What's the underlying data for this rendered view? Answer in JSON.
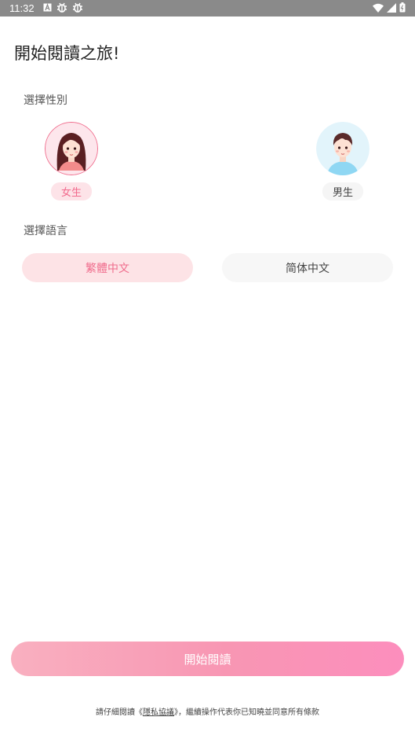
{
  "status_bar": {
    "time": "11:32",
    "left_icons": [
      "a-box-icon",
      "bug-icon",
      "bug-icon"
    ],
    "right_icons": [
      "wifi-icon",
      "signal-icon",
      "battery-icon"
    ]
  },
  "page": {
    "title": "開始閱讀之旅!"
  },
  "gender": {
    "label": "選擇性別",
    "options": [
      {
        "label": "女生",
        "selected": true
      },
      {
        "label": "男生",
        "selected": false
      }
    ]
  },
  "language": {
    "label": "選擇語言",
    "options": [
      {
        "label": "繁體中文",
        "selected": true
      },
      {
        "label": "简体中文",
        "selected": false
      }
    ]
  },
  "start_button": {
    "label": "開始閱讀"
  },
  "footer": {
    "prefix": "請仔細閱讀《",
    "link": "隱私協議",
    "suffix": "》，繼續操作代表你已知曉並同意所有條款"
  },
  "colors": {
    "accent_pink": "#f26a8d",
    "selected_bg": "#fde3e8",
    "status_bar": "#8a8a8a"
  }
}
